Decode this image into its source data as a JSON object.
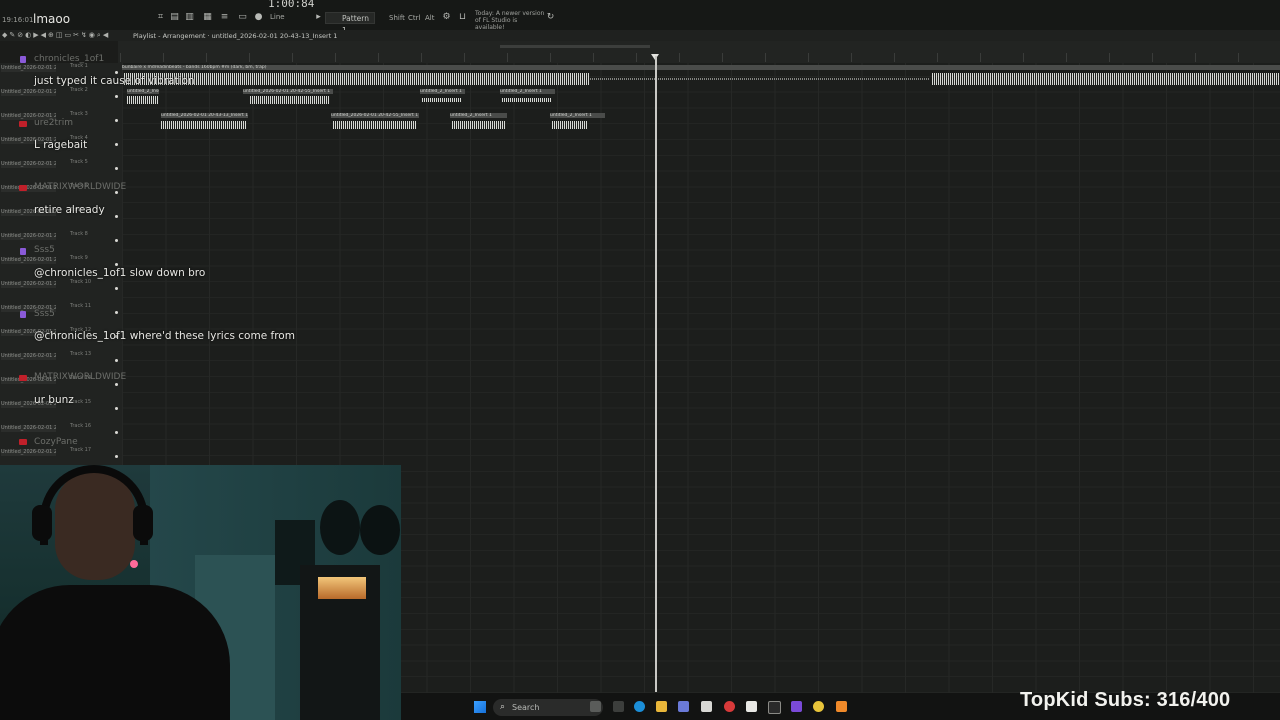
{
  "toolbar": {
    "clock": "19:16:01",
    "overlay_title": "lmaoo",
    "time_display": "1:00:84",
    "snap_mode": "Line",
    "pattern": "Pattern 1",
    "keys": [
      "Shift",
      "Ctrl",
      "Alt"
    ],
    "update_notice": "Today: A newer version of FL Studio is available!"
  },
  "playlist": {
    "title": "Playlist - Arrangement · untitled_2026-02-01 20-43-13_Insert 1"
  },
  "tracks": [
    {
      "file": "Untitled_2026-02-01 20-",
      "name": "Track 1"
    },
    {
      "file": "Untitled_2026-02-01 20-",
      "name": "Track 2"
    },
    {
      "file": "Untitled_2026-02-01 20-",
      "name": "Track 3"
    },
    {
      "file": "Untitled_2026-02-01 20-",
      "name": "Track 4"
    },
    {
      "file": "Untitled_2026-02-01 20-",
      "name": "Track 5"
    },
    {
      "file": "Untitled_2026-02-01 20-",
      "name": "Track 6"
    },
    {
      "file": "Untitled_2026-02-01 20-",
      "name": "Track 7"
    },
    {
      "file": "Untitled_2026-02-01 20-",
      "name": "Track 8"
    },
    {
      "file": "Untitled_2026-02-01 20-",
      "name": "Track 9"
    },
    {
      "file": "Untitled_2026-02-01 20-",
      "name": "Track 10"
    },
    {
      "file": "Untitled_2026-02-01 20-",
      "name": "Track 11"
    },
    {
      "file": "Untitled_2026-02-01 20-",
      "name": "Track 12"
    },
    {
      "file": "Untitled_2026-02-01 20-",
      "name": "Track 13"
    },
    {
      "file": "Untitled_2026-02-01 20-",
      "name": "Track 14"
    },
    {
      "file": "Untitled_2026-02-01 20-",
      "name": "Track 15"
    },
    {
      "file": "Untitled_2026-02-01 20-",
      "name": "Track 16"
    },
    {
      "file": "Untitled_2026-02-01 20-",
      "name": "Track 17"
    }
  ],
  "clips": {
    "beat": "bunbaire x mdreadinbeats - bands 160bpm #m (dark, bm, trap)",
    "vocal_a": "untitled_2026-02-01 20-43-13_Insert 1",
    "vocal_b": "untitled_2026-02-01 20-42-55_Insert 1",
    "vocal_c": "untitled_2_Insert 1"
  },
  "chat": [
    {
      "user": "chronicles_1of1",
      "message": "just typed it cause of vibration",
      "badge": "twitch"
    },
    {
      "user": "ure2trim",
      "message": "L ragebait",
      "badge": "youtube"
    },
    {
      "user": "MATRIXWORLDWIDE",
      "message": "retire already",
      "badge": "youtube"
    },
    {
      "user": "Sss5",
      "message": "@chronicles_1of1 slow down bro",
      "badge": "twitch"
    },
    {
      "user": "Sss5",
      "message": "@chronicles_1of1 where'd these lyrics come from",
      "badge": "twitch"
    },
    {
      "user": "MATRIXWORLDWIDE",
      "message": "ur bunz",
      "badge": "youtube"
    },
    {
      "user": "CozyPane",
      "message": "",
      "badge": "youtube"
    }
  ],
  "taskbar": {
    "search_placeholder": "Search"
  },
  "stream": {
    "subs_label": "TopKid Subs: 316/400"
  },
  "colors": {
    "youtube_badge": "#c0202a",
    "twitch_badge": "#8a5ad8",
    "playhead": "#c9c9c5"
  }
}
